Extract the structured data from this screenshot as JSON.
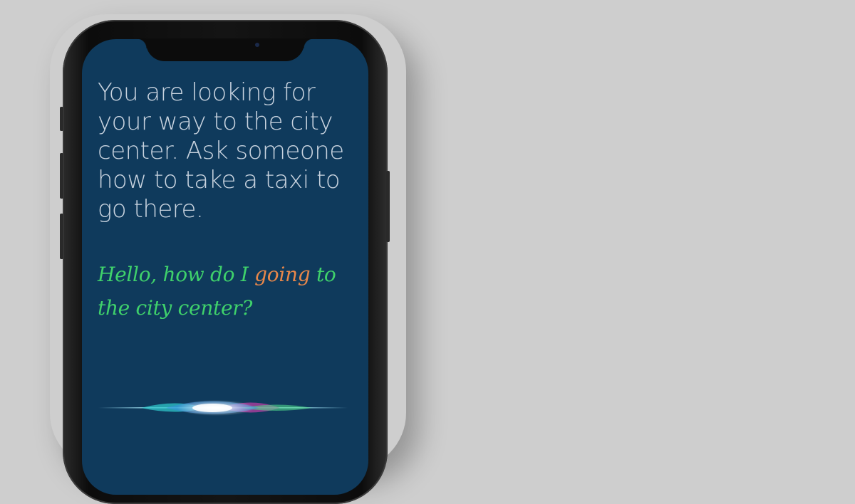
{
  "prompt": {
    "text": "You are looking for your way to the city center. Ask someone how to take a taxi to go there."
  },
  "speech": {
    "before": "Hello, how do I ",
    "error_word": "going",
    "after": " to the city center?"
  },
  "colors": {
    "background": "#cecece",
    "screen": "#0f3a5c",
    "prompt_text": "#c8d3df",
    "speech_text": "#3fd16b",
    "error_word": "#e8874a"
  },
  "icons": {
    "voice": "siri-waveform-icon"
  }
}
